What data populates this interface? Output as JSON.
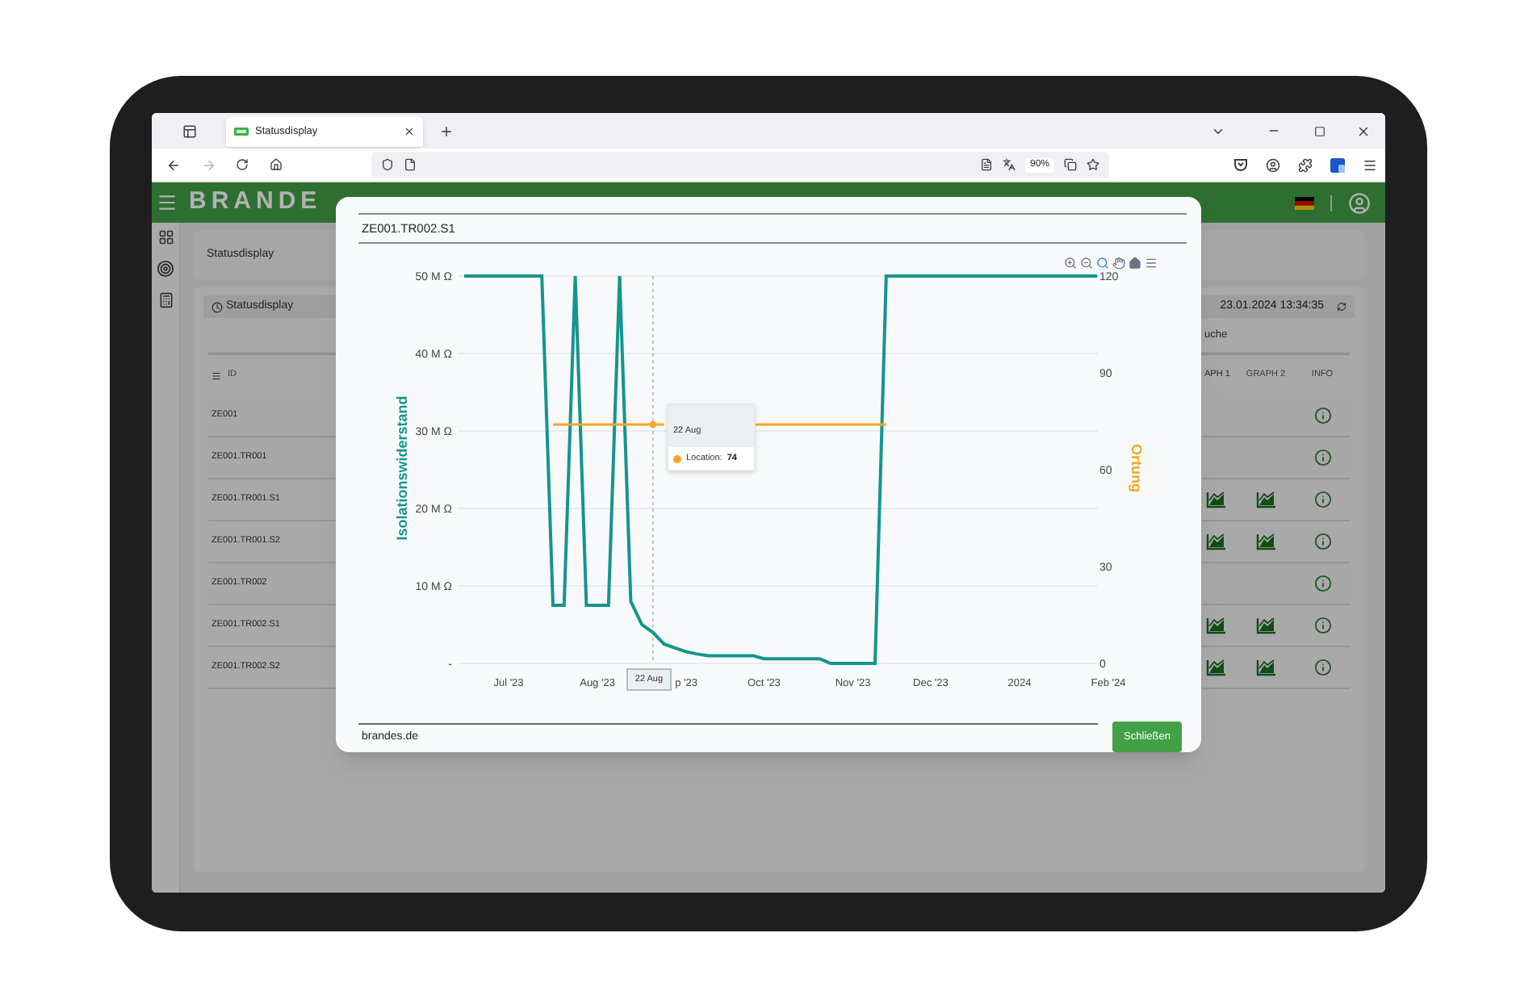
{
  "browser": {
    "tab": {
      "title": "Statusdisplay",
      "selected": true
    },
    "zoom": "90%"
  },
  "app": {
    "logo": "BRANDE",
    "page_title": "Statusdisplay",
    "card_title": "Statusdisplay",
    "timestamp": "23.01.2024 13:34:35",
    "search_placeholder": "uche",
    "table": {
      "columns": [
        "ID",
        "APH 1",
        "GRAPH 2",
        "INFO"
      ],
      "rows": [
        {
          "id": "ZE001",
          "graphs": false
        },
        {
          "id": "ZE001.TR001",
          "graphs": false
        },
        {
          "id": "ZE001.TR001.S1",
          "graphs": true
        },
        {
          "id": "ZE001.TR001.S2",
          "graphs": true
        },
        {
          "id": "ZE001.TR002",
          "graphs": false
        },
        {
          "id": "ZE001.TR002.S1",
          "graphs": true
        },
        {
          "id": "ZE001.TR002.S2",
          "graphs": true
        }
      ]
    }
  },
  "dialog": {
    "title": "ZE001.TR002.S1",
    "tools": [
      {
        "kind": "zoom-in",
        "selected": false
      },
      {
        "kind": "zoom-out",
        "selected": false
      },
      {
        "kind": "zoom",
        "selected": true
      },
      {
        "kind": "pan",
        "selected": false
      },
      {
        "kind": "home",
        "selected": false
      },
      {
        "kind": "menu",
        "selected": false
      }
    ],
    "chart_data": {
      "type": "line",
      "categories": [
        null,
        null,
        null,
        null,
        null,
        "Jul '23",
        null,
        null,
        null,
        null,
        null,
        null,
        null,
        "Aug '23",
        null,
        null,
        null,
        null,
        null,
        null,
        null,
        "p '23",
        null,
        null,
        null,
        null,
        null,
        null,
        "Oct '23",
        null,
        null,
        null,
        null,
        null,
        null,
        null,
        "Nov '23",
        null,
        null,
        null,
        null,
        null,
        null,
        "Dec '23",
        null,
        null,
        null,
        null,
        null,
        null,
        null,
        "2024",
        null,
        null,
        null,
        null,
        null,
        null,
        null,
        "Feb '24"
      ],
      "grid": true,
      "series": [
        {
          "name": "Isolationswiderstand",
          "color": "#14958f",
          "values": [
            null,
            50,
            50,
            50,
            50,
            50,
            50,
            50,
            50,
            7.5,
            7.5,
            50,
            7.5,
            7.5,
            7.5,
            50,
            8,
            5,
            4,
            2.5,
            2,
            1.5,
            1.2,
            1,
            1,
            1,
            1,
            1,
            0.6,
            0.6,
            0.6,
            0.6,
            0.6,
            0.6,
            0,
            0,
            0,
            0,
            0,
            50,
            50,
            50,
            50,
            50,
            50,
            50,
            50,
            50,
            50,
            50,
            50,
            50,
            50,
            50,
            50,
            50,
            50,
            50,
            50,
            null
          ]
        },
        {
          "name": "Ortung",
          "color": "#f5a623",
          "axis": "y2",
          "values": [
            null,
            null,
            null,
            null,
            null,
            null,
            null,
            null,
            null,
            74,
            74,
            74,
            74,
            74,
            74,
            74,
            74,
            74,
            74,
            74,
            null,
            null,
            null,
            null,
            null,
            null,
            null,
            74,
            74,
            74,
            74,
            74,
            74,
            74,
            74,
            74,
            74,
            74,
            74,
            74,
            null,
            null,
            null,
            null,
            null,
            null,
            null,
            null,
            null,
            null,
            null,
            null,
            null,
            null,
            null,
            null,
            null,
            null,
            null,
            null
          ]
        }
      ],
      "ylim": [
        0,
        50
      ],
      "y2lim": [
        0,
        120
      ],
      "yticks": [
        {
          "value": 0,
          "label": "-"
        },
        {
          "value": 10,
          "label": "10 M Ω"
        },
        {
          "value": 20,
          "label": "20 M Ω"
        },
        {
          "value": 30,
          "label": "30 M Ω"
        },
        {
          "value": 40,
          "label": "40 M Ω"
        },
        {
          "value": 50,
          "label": "50 M Ω"
        }
      ],
      "y2ticks": [
        0,
        30,
        60,
        90,
        120
      ],
      "annotations": [
        {
          "text": "22 Aug"
        }
      ]
    },
    "tooltip": {
      "title": "22 Aug",
      "label": "Location:",
      "value": "74"
    },
    "footer": "brandes.de",
    "close_button": "Schließen"
  }
}
